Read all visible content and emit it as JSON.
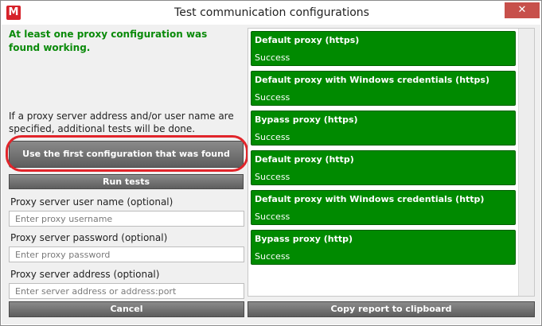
{
  "window": {
    "title": "Test communication configurations",
    "icon_letter": "M",
    "close_glyph": "✕"
  },
  "left": {
    "status_message": "At least one proxy configuration was found working.",
    "info_text": "If a proxy server address and/or user name are specified, additional tests will be done.",
    "use_first_button": "Use the first configuration that was found",
    "run_tests_button": "Run tests",
    "username_label": "Proxy server user name (optional)",
    "username_placeholder": "Enter proxy username",
    "password_label": "Proxy server password (optional)",
    "password_placeholder": "Enter proxy password",
    "address_label": "Proxy server address (optional)",
    "address_placeholder": "Enter server address or address:port",
    "cancel_button": "Cancel"
  },
  "results": {
    "copy_button": "Copy report to clipboard",
    "items": [
      {
        "title": "Default proxy (https)",
        "status": "Success"
      },
      {
        "title": "Default proxy with Windows credentials (https)",
        "status": "Success"
      },
      {
        "title": "Bypass proxy (https)",
        "status": "Success"
      },
      {
        "title": "Default proxy (http)",
        "status": "Success"
      },
      {
        "title": "Default proxy with Windows credentials (http)",
        "status": "Success"
      },
      {
        "title": "Bypass proxy (http)",
        "status": "Success"
      }
    ]
  },
  "colors": {
    "success": "#008a00",
    "status_ok_text": "#0a8a0a",
    "highlight": "#e1242a",
    "button_dark": "#6e6e6e"
  }
}
